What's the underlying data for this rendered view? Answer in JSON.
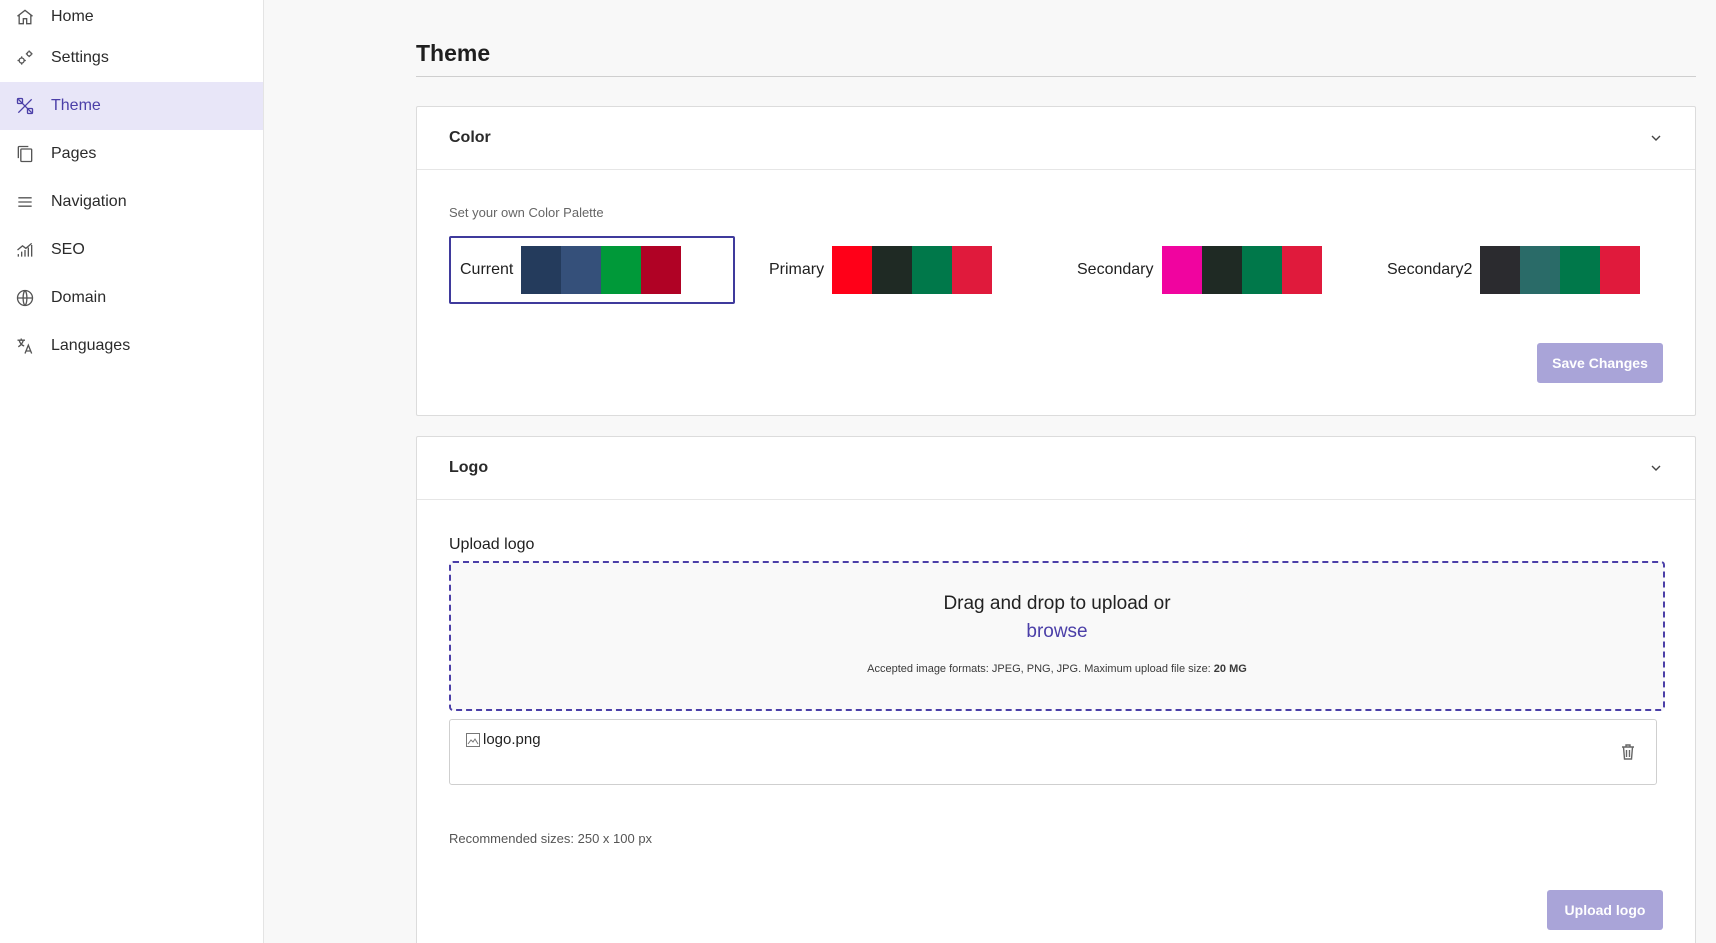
{
  "sidebar": {
    "items": [
      {
        "label": "Home",
        "icon": "home-icon"
      },
      {
        "label": "Settings",
        "icon": "settings-icon"
      },
      {
        "label": "Theme",
        "icon": "theme-icon",
        "active": true
      },
      {
        "label": "Pages",
        "icon": "pages-icon"
      },
      {
        "label": "Navigation",
        "icon": "menu-icon"
      },
      {
        "label": "SEO",
        "icon": "chart-icon"
      },
      {
        "label": "Domain",
        "icon": "globe-icon"
      },
      {
        "label": "Languages",
        "icon": "translate-icon"
      }
    ]
  },
  "page": {
    "title": "Theme"
  },
  "color_card": {
    "title": "Color",
    "subtitle": "Set your own Color Palette",
    "palettes": [
      {
        "name": "Current",
        "selected": true,
        "colors": [
          "#243b5c",
          "#35507a",
          "#009939",
          "#b00225"
        ]
      },
      {
        "name": "Primary",
        "selected": false,
        "colors": [
          "#ff0018",
          "#1f2a24",
          "#00784a",
          "#e01a3c"
        ]
      },
      {
        "name": "Secondary",
        "selected": false,
        "colors": [
          "#f0049f",
          "#1f2a24",
          "#00784a",
          "#e01a3c"
        ]
      },
      {
        "name": "Secondary2",
        "selected": false,
        "colors": [
          "#2b2b2f",
          "#2a6b68",
          "#00784a",
          "#e01a3c"
        ]
      }
    ],
    "save_label": "Save Changes"
  },
  "logo_card": {
    "title": "Logo",
    "upload_label": "Upload logo",
    "dropzone": {
      "main_text": "Drag and drop to upload or",
      "browse_text": "browse",
      "note_text": "Accepted image formats: JPEG, PNG, JPG. Maximum upload file size: ",
      "note_max": "20 MG"
    },
    "file_name": "logo.png",
    "recommended": "Recommended sizes: 250 x 100 px",
    "upload_button": "Upload logo"
  },
  "colors": {
    "accent": "#4b3fa8",
    "button": "#a9a4d8",
    "active_bg": "#e8e6f8"
  }
}
